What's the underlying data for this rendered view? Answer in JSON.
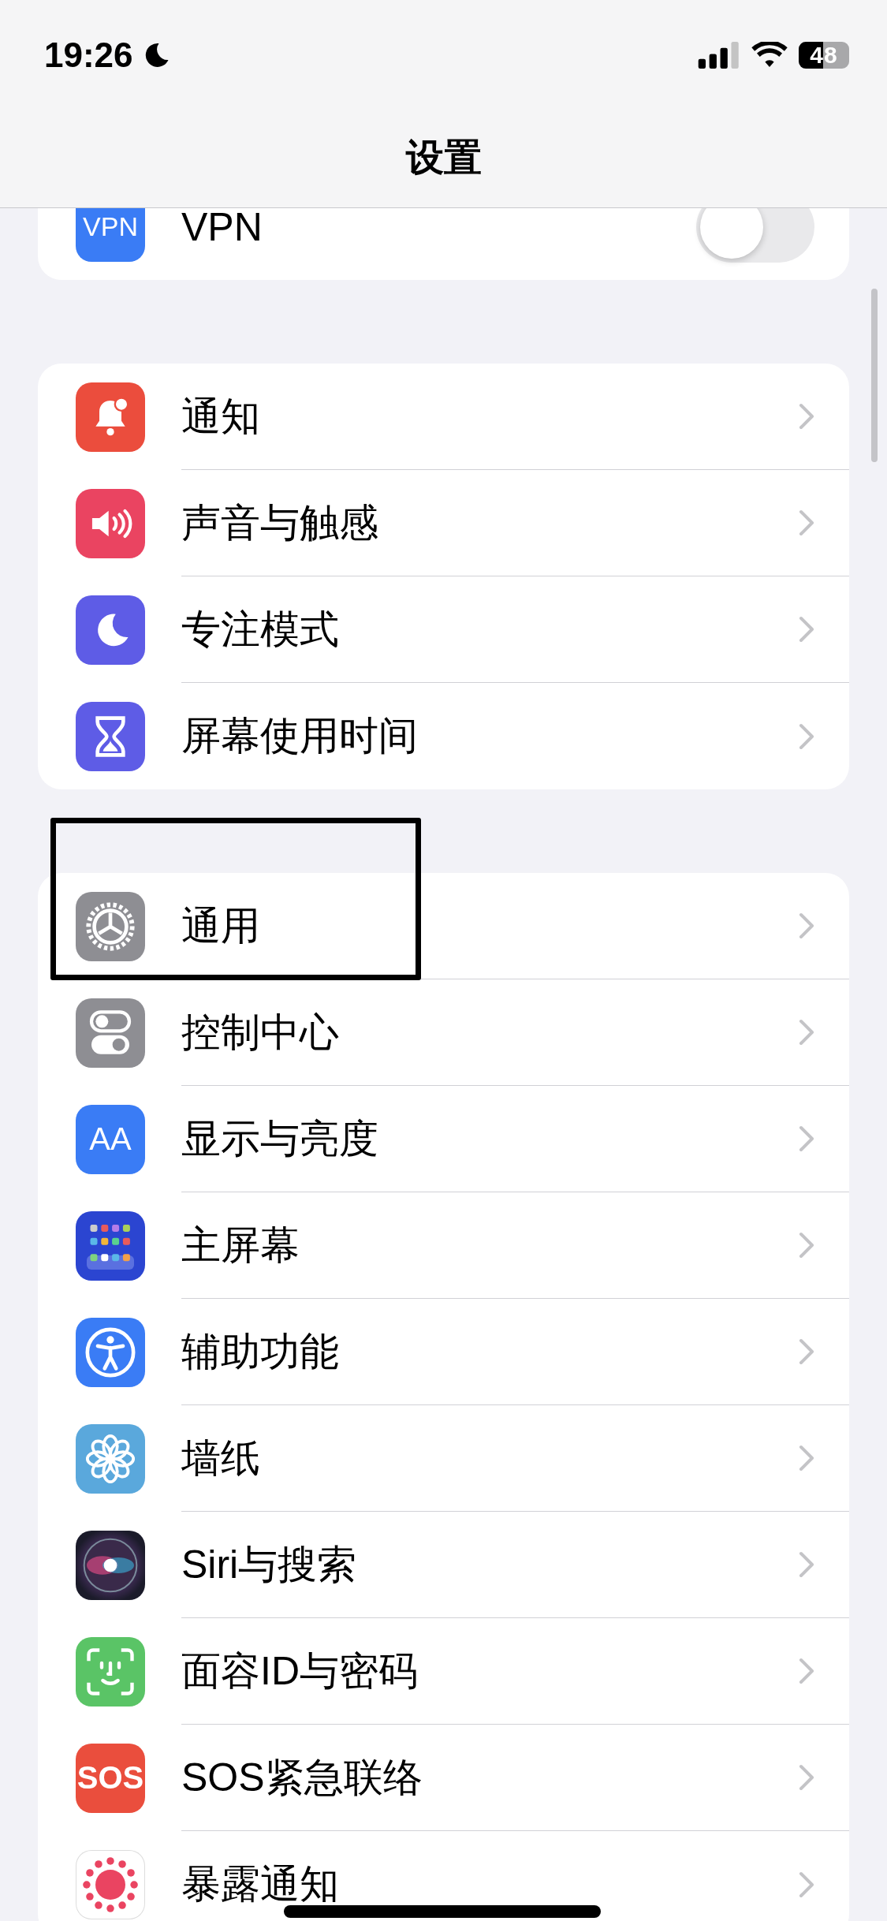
{
  "status_bar": {
    "time": "19:26",
    "battery": "48"
  },
  "nav": {
    "title": "设置"
  },
  "groups": [
    {
      "rows": [
        {
          "kind": "vpn",
          "icon_text": "VPN",
          "label": "VPN",
          "on": false
        }
      ]
    },
    {
      "rows": [
        {
          "kind": "bell",
          "label": "通知"
        },
        {
          "kind": "speaker",
          "label": "声音与触感"
        },
        {
          "kind": "moon",
          "label": "专注模式"
        },
        {
          "kind": "hourglass",
          "label": "屏幕使用时间"
        }
      ]
    },
    {
      "rows": [
        {
          "kind": "gear",
          "label": "通用",
          "highlighted": true
        },
        {
          "kind": "switches",
          "label": "控制中心"
        },
        {
          "kind": "display",
          "icon_text": "AA",
          "label": "显示与亮度"
        },
        {
          "kind": "homescreen",
          "label": "主屏幕"
        },
        {
          "kind": "accessibility",
          "label": "辅助功能"
        },
        {
          "kind": "flower",
          "label": "墙纸"
        },
        {
          "kind": "siri",
          "label": "Siri与搜索"
        },
        {
          "kind": "faceid",
          "label": "面容ID与密码"
        },
        {
          "kind": "sos",
          "icon_text": "SOS",
          "label": "SOS紧急联络"
        },
        {
          "kind": "exposure",
          "label": "暴露通知"
        }
      ]
    }
  ]
}
